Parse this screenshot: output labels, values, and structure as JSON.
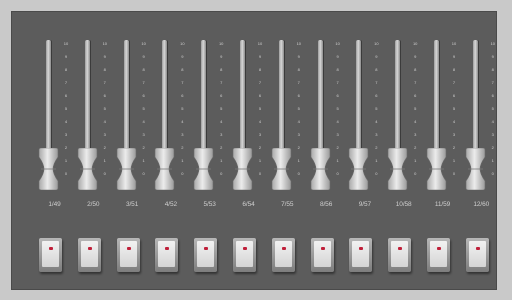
{
  "colors": {
    "panel": "#5c5c5c",
    "led": "#c0203a",
    "background": "#c9c9c9"
  },
  "scale_ticks": [
    "10",
    "9",
    "8",
    "7",
    "6",
    "5",
    "4",
    "3",
    "2",
    "1",
    "0"
  ],
  "channels": [
    {
      "label": "1/49",
      "level": 0
    },
    {
      "label": "2/50",
      "level": 0
    },
    {
      "label": "3/51",
      "level": 0
    },
    {
      "label": "4/52",
      "level": 0
    },
    {
      "label": "5/53",
      "level": 0
    },
    {
      "label": "6/54",
      "level": 0
    },
    {
      "label": "7/55",
      "level": 0
    },
    {
      "label": "8/56",
      "level": 0
    },
    {
      "label": "9/57",
      "level": 0
    },
    {
      "label": "10/58",
      "level": 0
    },
    {
      "label": "11/59",
      "level": 0
    },
    {
      "label": "12/60",
      "level": 0
    }
  ]
}
